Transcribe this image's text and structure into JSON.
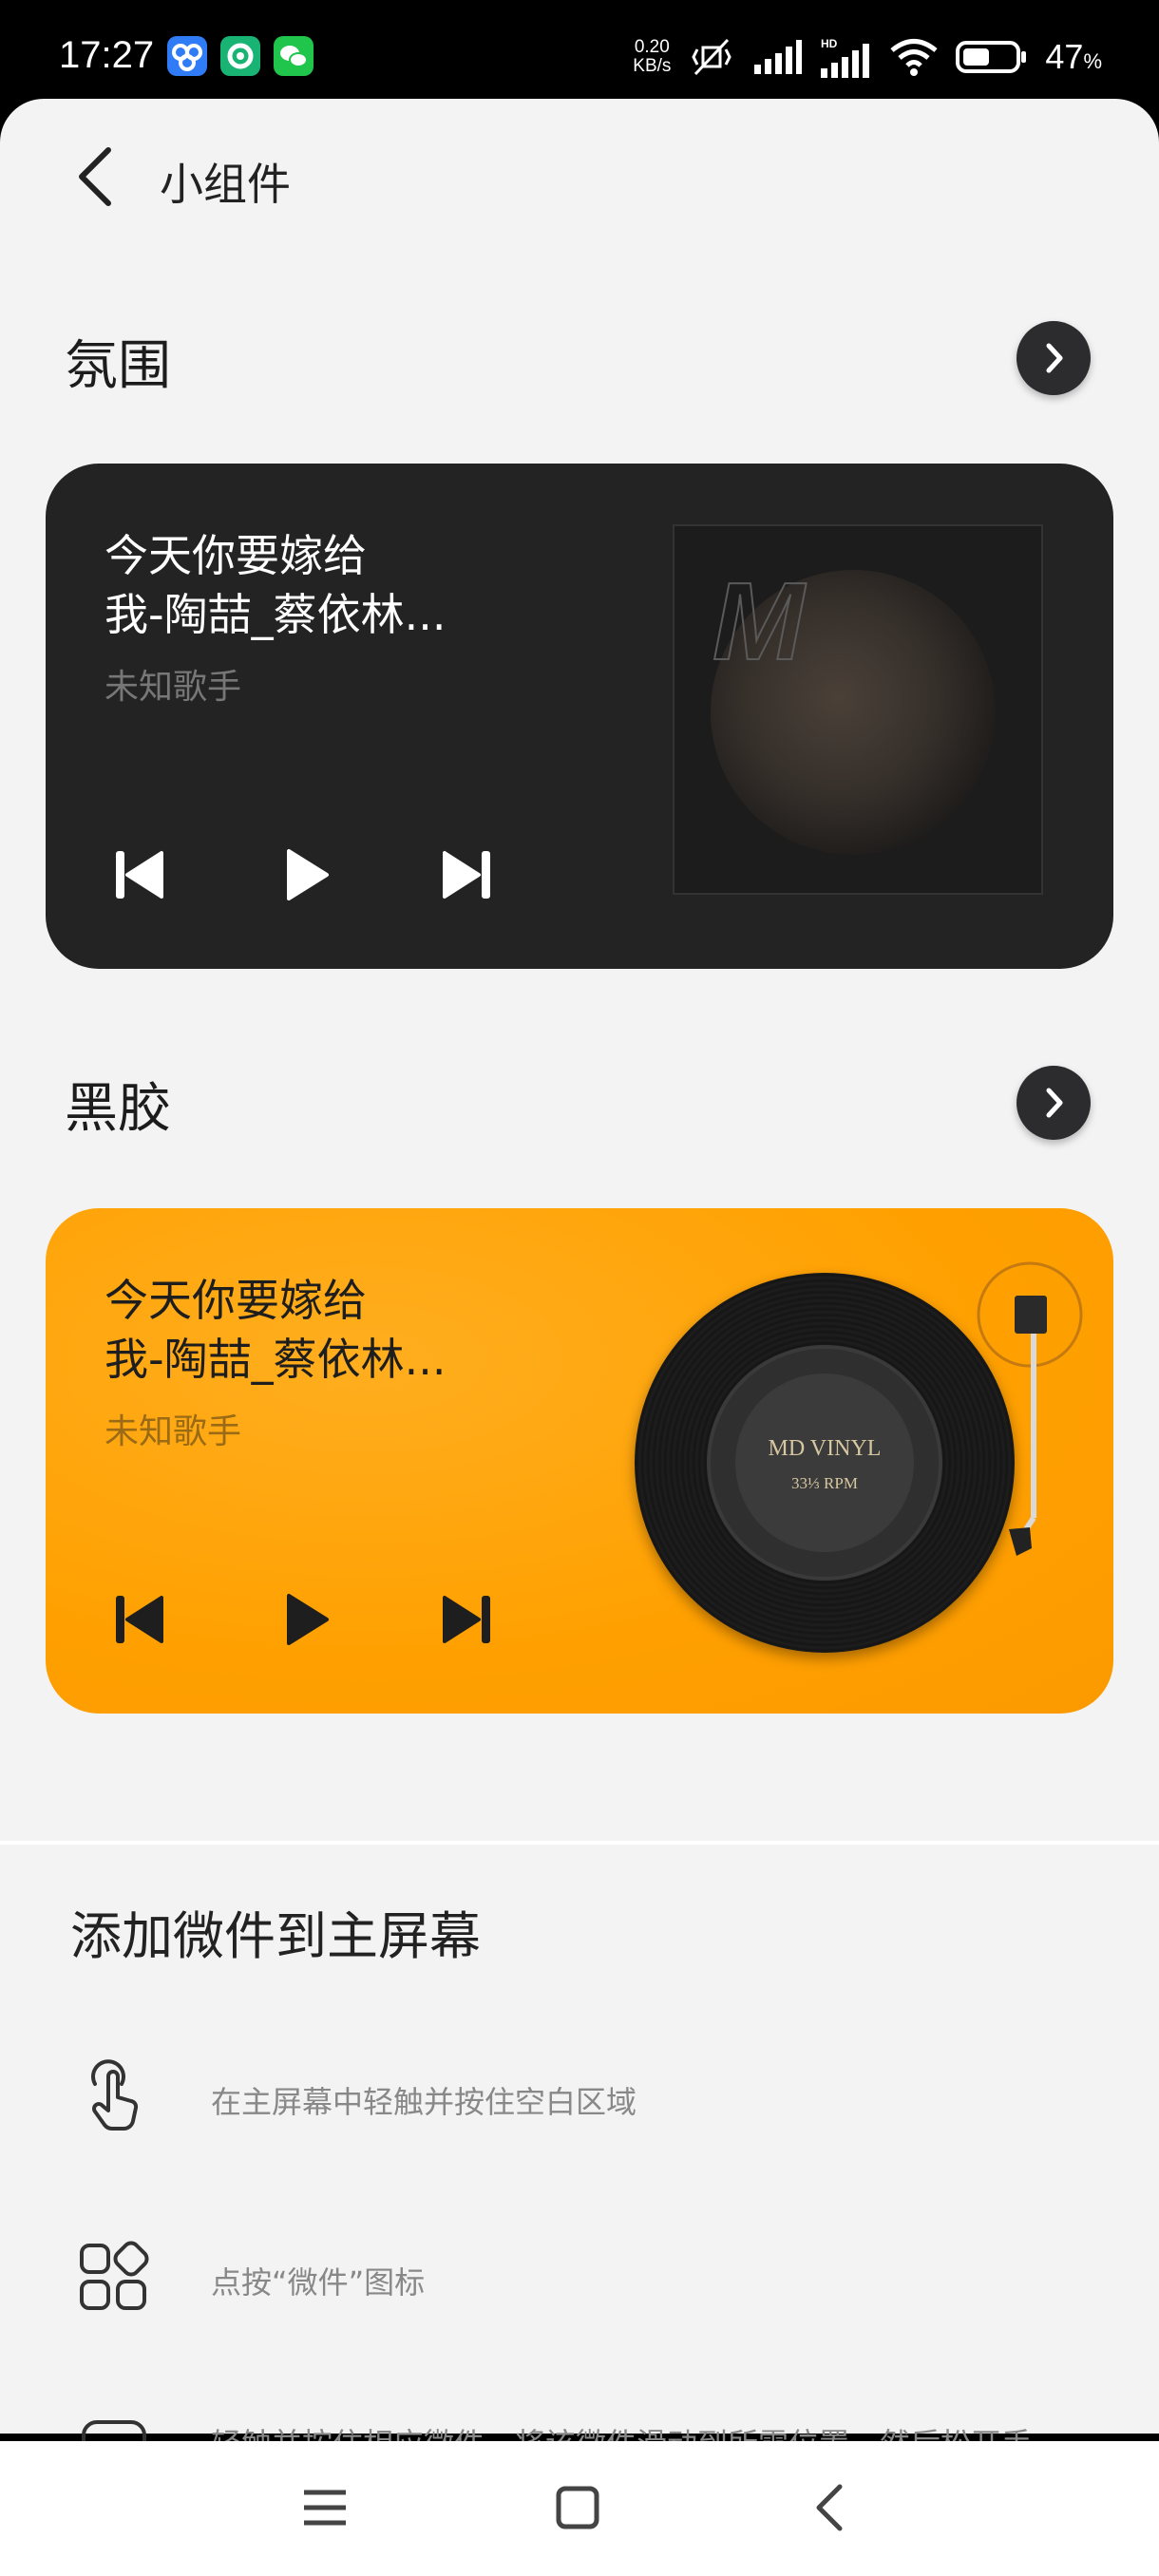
{
  "status_bar": {
    "time": "17:27",
    "net_speed_value": "0.20",
    "net_speed_unit": "KB/s",
    "battery_percent": "47",
    "battery_percent_sign": "%",
    "icons": [
      "baidu-netdisk-icon",
      "green-app-icon",
      "wechat-icon",
      "mute-vibrate-icon",
      "signal-icon",
      "hd-signal-icon",
      "wifi-icon",
      "battery-icon"
    ]
  },
  "header": {
    "title": "小组件"
  },
  "sections": [
    {
      "title": "氛围",
      "song_line1": "今天你要嫁给",
      "song_line2": "我-陶喆_蔡依林...",
      "artist": "未知歌手",
      "album_mark": "M"
    },
    {
      "title": "黑胶",
      "song_line1": "今天你要嫁给",
      "song_line2": "我-陶喆_蔡依林...",
      "artist": "未知歌手",
      "vinyl_label_1": "MD VINYL",
      "vinyl_label_2": "33⅓ RPM"
    }
  ],
  "instructions": {
    "title": "添加微件到主屏幕",
    "steps": [
      {
        "icon": "touch-hand-icon",
        "text": "在主屏幕中轻触并按住空白区域"
      },
      {
        "icon": "widgets-grid-icon",
        "text": "点按“微件”图标"
      },
      {
        "icon": "widget-card-icon",
        "text": "轻触并按住相应微件，将该微件滑动到所需位置，然后松开手"
      }
    ]
  },
  "colors": {
    "accent_orange": "#ffa000",
    "dark_card": "#232323",
    "background": "#f3f3f3"
  }
}
